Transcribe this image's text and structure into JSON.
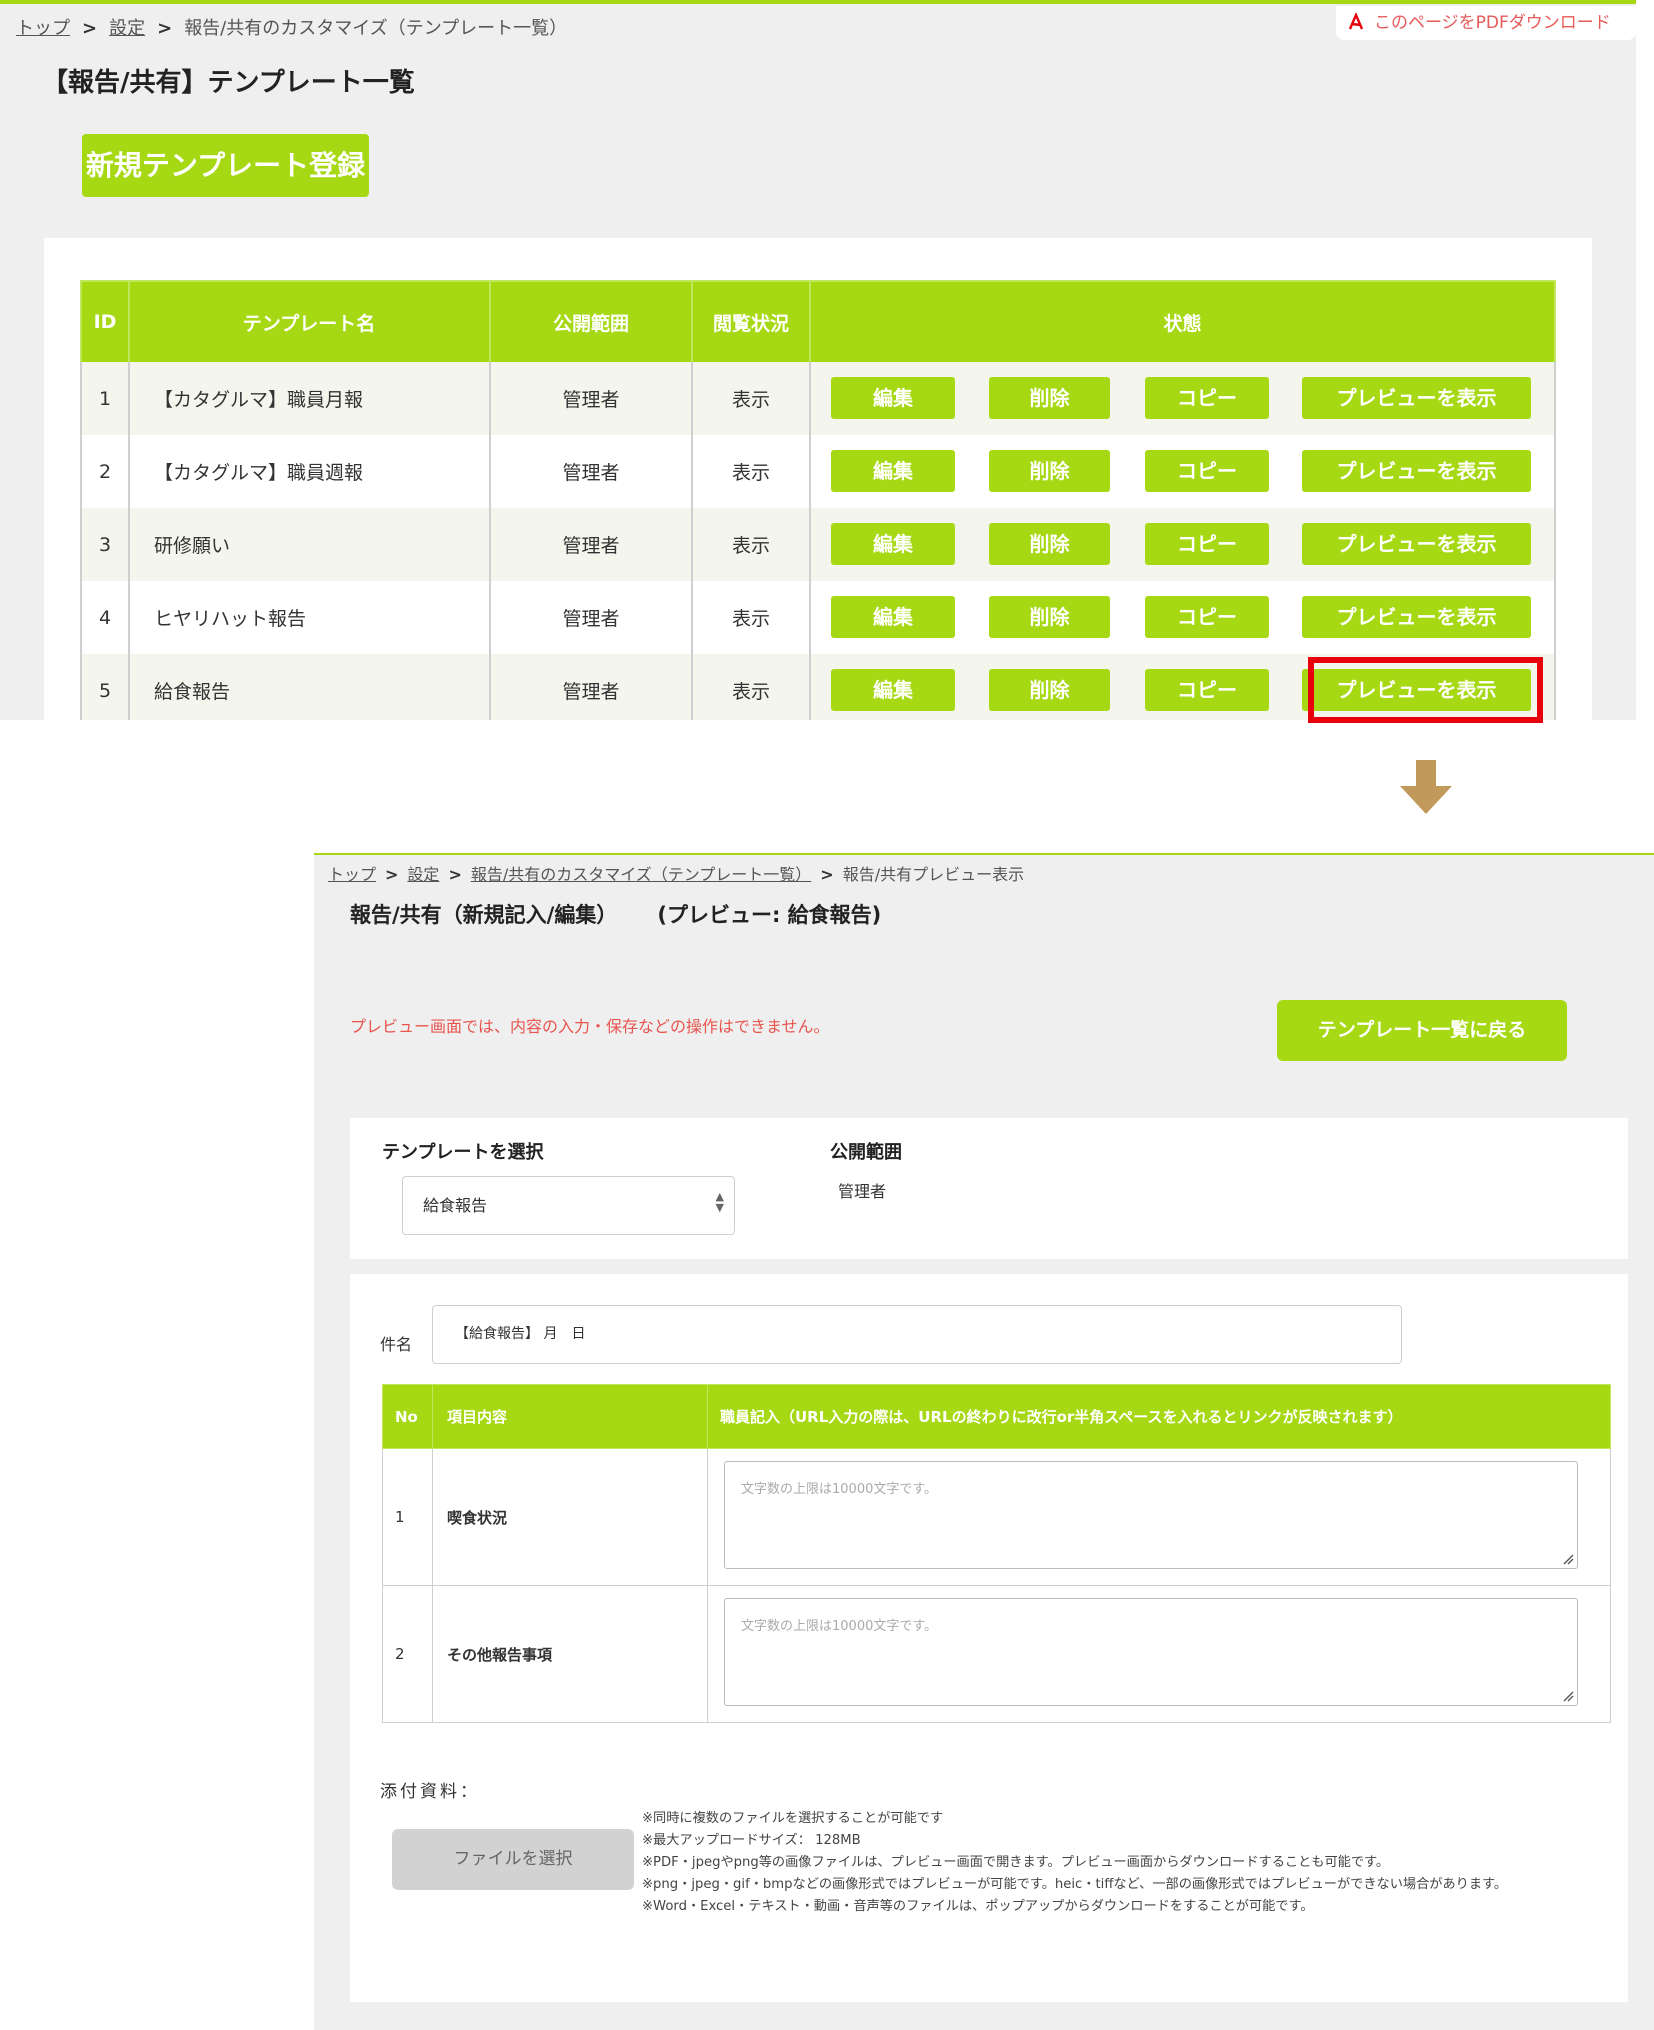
{
  "top": {
    "breadcrumb": [
      "トップ",
      "設定",
      "報告/共有のカスタマイズ（テンプレート一覧）"
    ],
    "pdf_link": "このページをPDFダウンロード",
    "title": "【報告/共有】テンプレート一覧",
    "new_button": "新規テンプレート登録",
    "table": {
      "headers": [
        "ID",
        "テンプレート名",
        "公開範囲",
        "閲覧状況",
        "状態"
      ],
      "button_labels": {
        "edit": "編集",
        "delete": "削除",
        "copy": "コピー",
        "preview": "プレビューを表示"
      },
      "rows": [
        {
          "id": "1",
          "name": "【カタグルマ】職員月報",
          "scope": "管理者",
          "view": "表示"
        },
        {
          "id": "2",
          "name": "【カタグルマ】職員週報",
          "scope": "管理者",
          "view": "表示"
        },
        {
          "id": "3",
          "name": "研修願い",
          "scope": "管理者",
          "view": "表示"
        },
        {
          "id": "4",
          "name": "ヒヤリハット報告",
          "scope": "管理者",
          "view": "表示"
        },
        {
          "id": "5",
          "name": "給食報告",
          "scope": "管理者",
          "view": "表示"
        }
      ]
    }
  },
  "bottom": {
    "breadcrumb": [
      "トップ",
      "設定",
      "報告/共有のカスタマイズ（テンプレート一覧）",
      "報告/共有プレビュー表示"
    ],
    "title": "報告/共有（新規記入/編集）",
    "preview_title": "(プレビュー: 給食報告)",
    "notice": "プレビュー画面では、内容の入力・保存などの操作はできません。",
    "back_button": "テンプレート一覧に戻る",
    "select_label": "テンプレートを選択",
    "select_value": "給食報告",
    "scope_label": "公開範囲",
    "scope_value": "管理者",
    "subject_label": "件名",
    "subject_value": "【給食報告】 月　日",
    "item_table": {
      "headers": [
        "No",
        "項目内容",
        "職員記入（URL入力の際は、URLの終わりに改行or半角スペースを入れるとリンクが反映されます）"
      ],
      "rows": [
        {
          "no": "1",
          "item": "喫食状況",
          "placeholder": "文字数の上限は10000文字です。"
        },
        {
          "no": "2",
          "item": "その他報告事項",
          "placeholder": "文字数の上限は10000文字です。"
        }
      ]
    },
    "attachment_label": "添付資料：",
    "file_button": "ファイルを選択",
    "notes": [
      "※同時に複数のファイルを選択することが可能です",
      "※最大アップロードサイズ： 128MB",
      "※PDF・jpegやpng等の画像ファイルは、プレビュー画面で開きます。プレビュー画面からダウンロードすることも可能です。",
      "※png・jpeg・gif・bmpなどの画像形式ではプレビューが可能です。heic・tiffなど、一部の画像形式ではプレビューができない場合があります。",
      "※Word・Excel・テキスト・動画・音声等のファイルは、ポップアップからダウンロードをすることが可能です。"
    ]
  },
  "colors": {
    "accent": "#a6d813",
    "highlight": "#e8000b",
    "arrow": "#c19a5b",
    "notice": "#e8554e"
  }
}
